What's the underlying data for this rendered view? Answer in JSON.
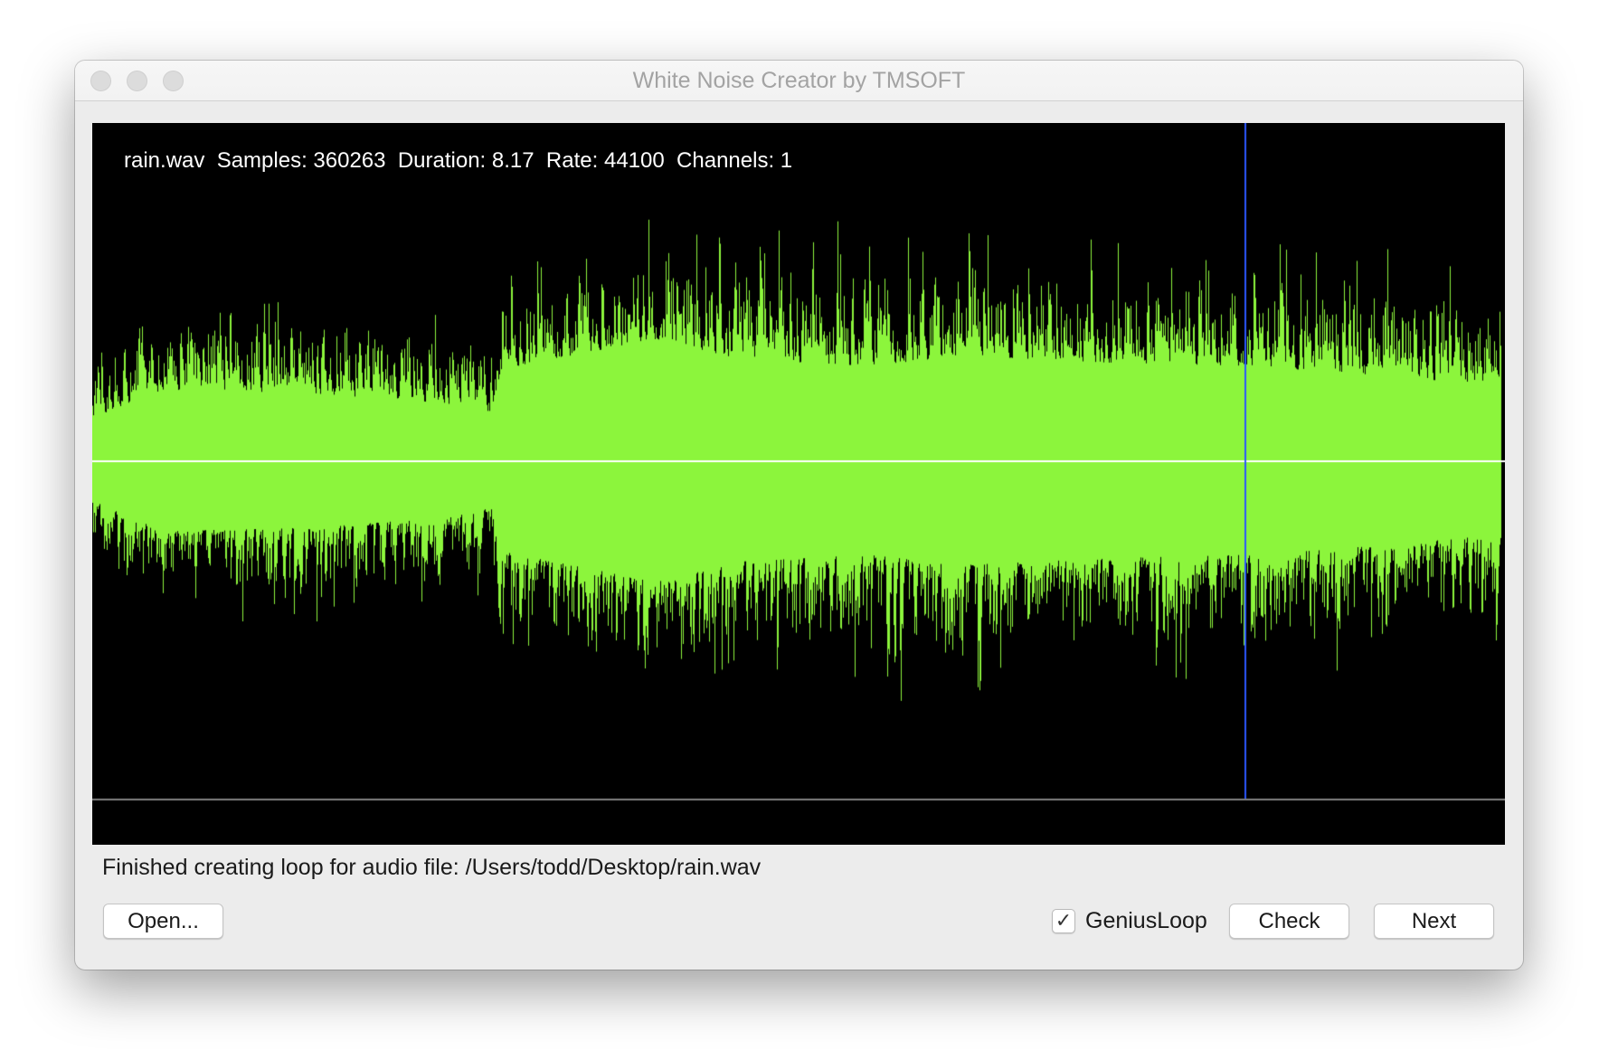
{
  "window": {
    "title": "White Noise Creator by TMSOFT",
    "traffic_lights": [
      "close",
      "minimize",
      "zoom"
    ]
  },
  "waveform": {
    "info_text": "rain.wav  Samples: 360263  Duration: 8.17  Rate: 44100  Channels: 1",
    "file_name": "rain.wav",
    "samples": 360263,
    "duration_seconds": 8.17,
    "rate": 44100,
    "channels": 1,
    "cursor_position_fraction": 0.818,
    "colors": {
      "background": "#000000",
      "wave": "#8cf53c",
      "center_line": "#ffffff",
      "cursor": "#2b57ff",
      "baseline": "#808080"
    },
    "envelope": [
      {
        "t": 0.0,
        "base": 0.12,
        "peak": 0.35
      },
      {
        "t": 0.05,
        "base": 0.21,
        "peak": 0.52
      },
      {
        "t": 0.15,
        "base": 0.2,
        "peak": 0.48
      },
      {
        "t": 0.25,
        "base": 0.17,
        "peak": 0.44
      },
      {
        "t": 0.283,
        "base": 0.14,
        "peak": 0.4
      },
      {
        "t": 0.29,
        "base": 0.27,
        "peak": 0.58
      },
      {
        "t": 0.4,
        "base": 0.36,
        "peak": 0.74
      },
      {
        "t": 0.46,
        "base": 0.3,
        "peak": 0.68
      },
      {
        "t": 0.55,
        "base": 0.28,
        "peak": 0.66
      },
      {
        "t": 0.62,
        "base": 0.31,
        "peak": 0.7
      },
      {
        "t": 0.72,
        "base": 0.29,
        "peak": 0.66
      },
      {
        "t": 0.82,
        "base": 0.28,
        "peak": 0.66
      },
      {
        "t": 0.92,
        "base": 0.25,
        "peak": 0.6
      },
      {
        "t": 1.0,
        "base": 0.22,
        "peak": 0.55
      }
    ]
  },
  "status_text": "Finished creating loop for audio file: /Users/todd/Desktop/rain.wav",
  "controls": {
    "open_label": "Open...",
    "genius_loop": {
      "label": "GeniusLoop",
      "checked": true,
      "check_glyph": "✓"
    },
    "check_label": "Check",
    "next_label": "Next"
  }
}
